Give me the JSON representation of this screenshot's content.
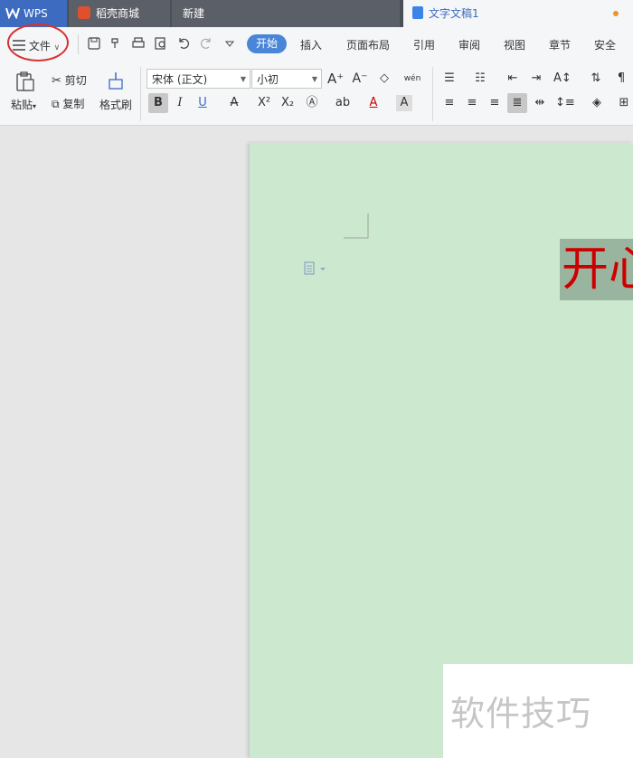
{
  "tabs": [
    {
      "label": "WPS"
    },
    {
      "label": "稻壳商城"
    },
    {
      "label": "新建"
    },
    {
      "label": "文字文稿1"
    }
  ],
  "menu": {
    "file": "文件",
    "items": [
      "开始",
      "插入",
      "页面布局",
      "引用",
      "审阅",
      "视图",
      "章节",
      "安全"
    ]
  },
  "ribbon": {
    "paste": "粘贴",
    "cut": "剪切",
    "copy": "复制",
    "format_painter": "格式刷",
    "font_name": "宋体 (正文)",
    "font_size": "小初",
    "bold": "B",
    "italic": "I",
    "underline": "U",
    "phonetic": "wén"
  },
  "document": {
    "text": "开心"
  },
  "watermark": "软件技巧",
  "colors": {
    "accent": "#4a86d8",
    "page": "#cce8cf",
    "text_red": "#cc0000",
    "annotation": "#d93030"
  }
}
